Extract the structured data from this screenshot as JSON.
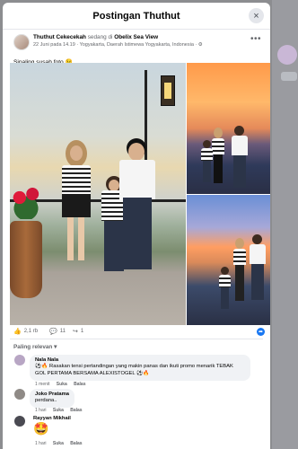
{
  "modal": {
    "title": "Postingan Thuthut",
    "close_icon": "×"
  },
  "post": {
    "author": "Thuthut Cekecekah",
    "status_prefix": "sedang di",
    "location_name": "Obelix Sea View",
    "meta": "22 Juni pada 14.19 · Yogyakarta, Daerah Istimewa Yogyakarta, Indonesia · ",
    "privacy_icon": "⚙",
    "more_icon": "•••",
    "caption": "Sipaling susah foto 😉"
  },
  "reactions": {
    "likes": "2,1 rb",
    "comments": "11",
    "shares": "1",
    "like_icon": "👍",
    "comment_icon": "💬",
    "share_icon": "↪"
  },
  "sort_label": "Paling relevan ▾",
  "comments": [
    {
      "name": "Nala Nala",
      "text": "⚽🔥 Rasakan tensi pertandingan yang makin panas dan ikuti promo menarik TEBAK GOL PERTAMA BERSAMA ALEXISTOGEL ⚽🔥",
      "time": "1 menit",
      "like": "Suka",
      "reply": "Balas",
      "avatar_color": "#b8a6c4"
    },
    {
      "name": "Joko Pratama",
      "text": "perdana..",
      "time": "1 hari",
      "like": "Suka",
      "reply": "Balas",
      "avatar_color": "#8f8a86"
    },
    {
      "name": "Rayyan Mikhail",
      "text": "🤩",
      "time": "1 hari",
      "like": "Suka",
      "reply": "Balas",
      "avatar_color": "#4a4a52"
    }
  ],
  "colors": {
    "accent": "#1877f2",
    "muted": "#65676b",
    "bubble": "#f0f2f5"
  }
}
